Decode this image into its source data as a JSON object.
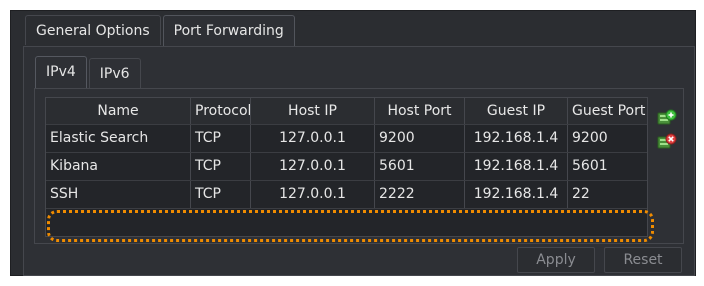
{
  "tabs": {
    "general": "General Options",
    "port_forwarding": "Port Forwarding"
  },
  "inner_tabs": {
    "ipv4": "IPv4",
    "ipv6": "IPv6"
  },
  "table": {
    "columns": [
      "Name",
      "Protocol",
      "Host IP",
      "Host Port",
      "Guest IP",
      "Guest Port"
    ],
    "rows": [
      [
        "Elastic Search",
        "TCP",
        "127.0.0.1",
        "9200",
        "192.168.1.4",
        "9200"
      ],
      [
        "Kibana",
        "TCP",
        "127.0.0.1",
        "5601",
        "192.168.1.4",
        "5601"
      ],
      [
        "SSH",
        "TCP",
        "127.0.0.1",
        "2222",
        "192.168.1.4",
        "22"
      ]
    ],
    "highlighted_row": "Kibana"
  },
  "icons": {
    "add": "add-rule-icon",
    "remove": "remove-rule-icon"
  },
  "buttons": {
    "apply": "Apply",
    "reset": "Reset"
  },
  "colors": {
    "highlight": "#f08c00",
    "add_icon": "#3fbf3f",
    "remove_icon": "#e04040"
  }
}
